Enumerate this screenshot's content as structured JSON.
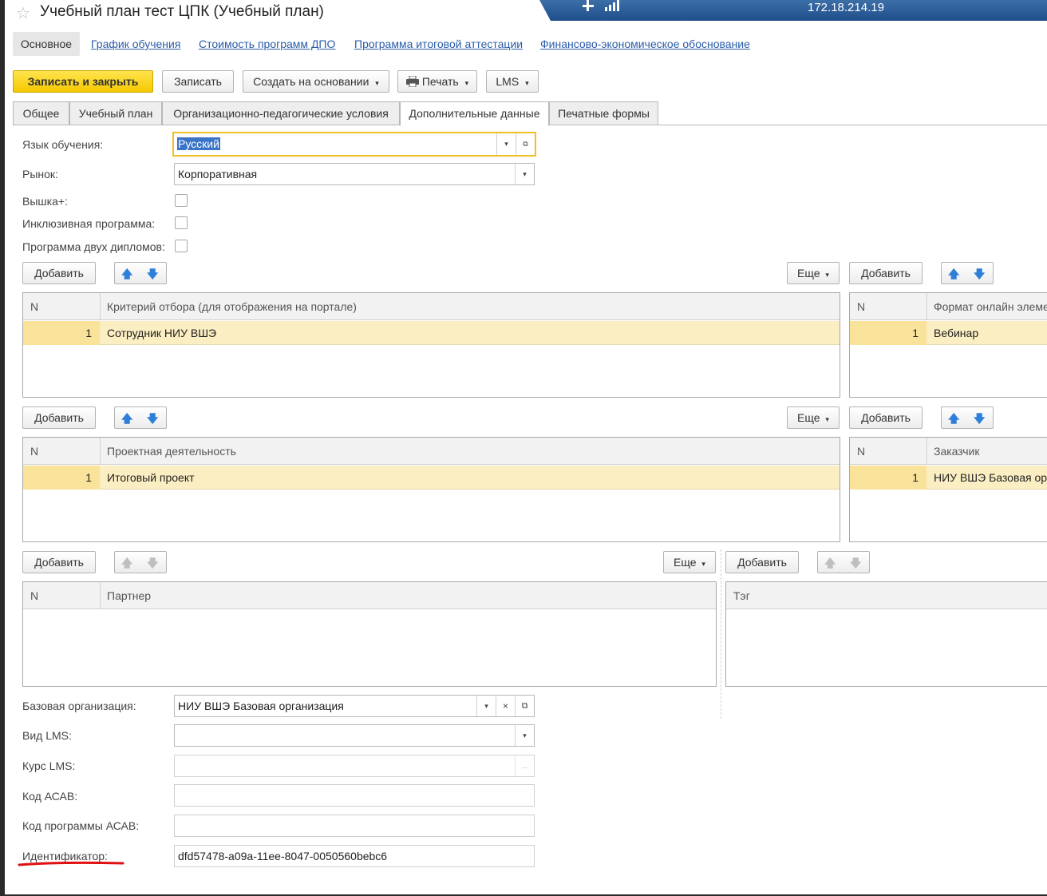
{
  "window": {
    "title": "Учебный план тест ЦПК (Учебный план)",
    "remote_ip": "172.18.214.19"
  },
  "nav": {
    "main": "Основное",
    "links": [
      "График обучения",
      "Стоимость программ ДПО",
      "Программа итоговой аттестации",
      "Финансово-экономическое обоснование"
    ]
  },
  "toolbar": {
    "save_close": "Записать и закрыть",
    "save": "Записать",
    "create_based": "Создать на основании",
    "print": "Печать",
    "lms": "LMS"
  },
  "tabs": [
    "Общее",
    "Учебный план",
    "Организационно-педагогические условия",
    "Дополнительные данные",
    "Печатные формы"
  ],
  "active_tab": "Дополнительные данные",
  "form": {
    "language": {
      "label": "Язык обучения:",
      "value": "Русский"
    },
    "market": {
      "label": "Рынок:",
      "value": "Корпоративная"
    },
    "vyshka_plus": {
      "label": "Вышка+:",
      "checked": false
    },
    "inclusive": {
      "label": "Инклюзивная программа:",
      "checked": false
    },
    "two_diplomas": {
      "label": "Программа двух дипломов:",
      "checked": false
    },
    "base_org": {
      "label": "Базовая организация:",
      "value": "НИУ ВШЭ Базовая организация"
    },
    "lms_type": {
      "label": "Вид LMS:",
      "value": ""
    },
    "lms_course": {
      "label": "Курс LMS:",
      "value": ""
    },
    "asav_code": {
      "label": "Код АСАВ:",
      "value": ""
    },
    "asav_program_code": {
      "label": "Код программы АСАВ:",
      "value": ""
    },
    "identifier": {
      "label": "Идентификатор:",
      "value": "dfd57478-a09a-11ee-8047-0050560bebc6"
    }
  },
  "buttons": {
    "add": "Добавить",
    "more": "Еще"
  },
  "tables": {
    "criteria": {
      "col_n": "N",
      "col_name": "Критерий отбора (для отображения на портале)",
      "rows": [
        {
          "n": "1",
          "value": "Сотрудник НИУ ВШЭ"
        }
      ]
    },
    "format": {
      "col_n": "N",
      "col_name": "Формат онлайн элеме",
      "rows": [
        {
          "n": "1",
          "value": "Вебинар"
        }
      ]
    },
    "project": {
      "col_n": "N",
      "col_name": "Проектная деятельность",
      "rows": [
        {
          "n": "1",
          "value": "Итоговый проект"
        }
      ]
    },
    "customer": {
      "col_n": "N",
      "col_name": "Заказчик",
      "rows": [
        {
          "n": "1",
          "value": "НИУ ВШЭ Базовая ор"
        }
      ]
    },
    "partner": {
      "col_n": "N",
      "col_name": "Партнер",
      "rows": []
    },
    "tag": {
      "col_name": "Тэг",
      "rows": []
    }
  },
  "icons": {
    "star": "☆",
    "arrow_up": "🡅",
    "arrow_down": "🡇",
    "dropdown": "▾",
    "open": "⧉",
    "clear": "×",
    "ellipsis": "..."
  },
  "colors": {
    "accent_yellow": "#f5c800",
    "row_highlight": "#fbeec2",
    "link": "#2a5ca8",
    "annotation_red": "#e01010"
  }
}
